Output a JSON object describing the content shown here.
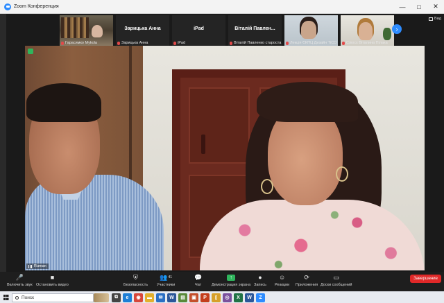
{
  "window": {
    "title": "Zoom Конференция",
    "minimize": "—",
    "maximize": "□",
    "close": "✕"
  },
  "thumbnails": [
    {
      "name": "Гарасимко Mykola",
      "type": "video-bookshelf"
    },
    {
      "name": "Зарицька Анна",
      "center_name": "Зарицька Анна",
      "type": "name-only"
    },
    {
      "name": "iPad",
      "center_name": "iPad",
      "type": "name-only"
    },
    {
      "name": "Віталій Павленко староста",
      "center_name": "Віталій Павлен...",
      "type": "name-only"
    },
    {
      "name": "Лекція ЄКПЦ Дизайн ТіСО",
      "type": "video-woman-1"
    },
    {
      "name": "Слюсх Віталина Пілака",
      "type": "video-woman-2"
    }
  ],
  "view_label": "Вид",
  "next_page_icon": "›",
  "main_video": {
    "speaker_label": "Ruman"
  },
  "toolbar": {
    "items": [
      {
        "icon": "🎤",
        "label": "Включить звук"
      },
      {
        "icon": "■",
        "label": "Остановить видео"
      },
      {
        "icon": "⛨",
        "label": "Безопасность"
      },
      {
        "icon": "👥",
        "label": "Участники",
        "count": "41"
      },
      {
        "icon": "💬",
        "label": "Чат"
      },
      {
        "icon": "↑",
        "label": "Демонстрация экрана"
      },
      {
        "icon": "●",
        "label": "Запись"
      },
      {
        "icon": "☺",
        "label": "Реакции"
      },
      {
        "icon": "⟳",
        "label": "Приложения"
      },
      {
        "icon": "▭",
        "label": "Доски сообщений"
      }
    ],
    "end_label": "Завершение"
  },
  "taskbar": {
    "search_placeholder": "Поиск",
    "apps": [
      {
        "name": "task-view",
        "glyph": "⧉",
        "color": "#444444"
      },
      {
        "name": "edge",
        "glyph": "e",
        "color": "#1e7fd6"
      },
      {
        "name": "chrome",
        "glyph": "◉",
        "color": "#d8473b"
      },
      {
        "name": "explorer",
        "glyph": "▬",
        "color": "#e3b02c"
      },
      {
        "name": "mail",
        "glyph": "✉",
        "color": "#2a6fc4"
      },
      {
        "name": "word",
        "glyph": "W",
        "color": "#2b579a"
      },
      {
        "name": "files",
        "glyph": "▤",
        "color": "#5a8a3a"
      },
      {
        "name": "photos",
        "glyph": "▣",
        "color": "#c44f2b"
      },
      {
        "name": "powerpoint",
        "glyph": "P",
        "color": "#c43e1c"
      },
      {
        "name": "tablet",
        "glyph": "▯",
        "color": "#d7a02a"
      },
      {
        "name": "viber",
        "glyph": "◎",
        "color": "#7b519d"
      },
      {
        "name": "excel",
        "glyph": "X",
        "color": "#217346"
      },
      {
        "name": "word2",
        "glyph": "W",
        "color": "#2b579a"
      },
      {
        "name": "zoom",
        "glyph": "Z",
        "color": "#2d8cff"
      }
    ]
  }
}
